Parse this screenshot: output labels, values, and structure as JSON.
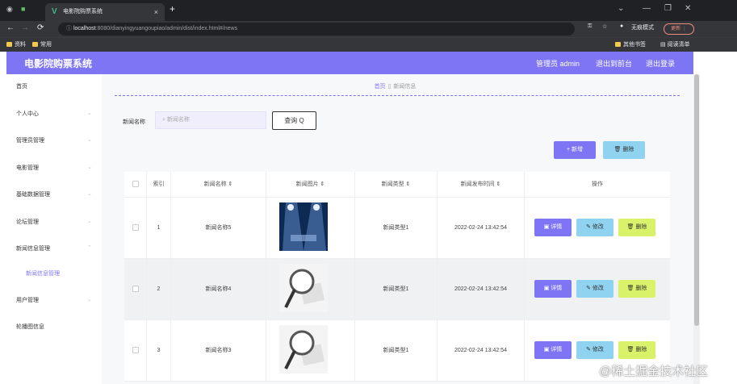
{
  "browser": {
    "tab_title": "电影院购票系统",
    "tab_favicon": "V",
    "close_tab": "×",
    "new_tab": "+",
    "address_host": "localhost",
    "address_rest": ":8080/dianyingyuangoupiao/admin/dist/index.html#/news",
    "incognito_label": "无痕模式",
    "profile_label": "更新 ⋮",
    "bookmarks": [
      "资料",
      "常用"
    ],
    "bookmarks_right": [
      "其他书签",
      "阅读清单"
    ]
  },
  "header": {
    "title": "电影院购票系统",
    "admin_label": "管理员 admin",
    "back_label": "退出到前台",
    "logout_label": "退出登录"
  },
  "sidebar": {
    "items": [
      {
        "label": "首页",
        "has_chevron": false
      },
      {
        "label": "个人中心",
        "has_chevron": true
      },
      {
        "label": "管理员管理",
        "has_chevron": true
      },
      {
        "label": "电影管理",
        "has_chevron": true
      },
      {
        "label": "基础数据管理",
        "has_chevron": true
      },
      {
        "label": "论坛管理",
        "has_chevron": true
      },
      {
        "label": "新闻信息管理",
        "has_chevron": true
      },
      {
        "label": "新闻信息管理",
        "sub": true
      },
      {
        "label": "用户管理",
        "has_chevron": true
      },
      {
        "label": "轮播图信息",
        "has_chevron": false
      }
    ]
  },
  "breadcrumb": {
    "home": "首页",
    "current": "新闻信息"
  },
  "search": {
    "label": "新闻名称",
    "placeholder": "新闻名称",
    "button_label": "查询 Q"
  },
  "actions": {
    "add_label": "+ 新增",
    "delete_label": "删除"
  },
  "table": {
    "headers": [
      "",
      "索引",
      "新闻名称 ⇕",
      "新闻图片 ⇕",
      "新闻类型 ⇕",
      "新闻发布时间 ⇕",
      "操作"
    ],
    "rows": [
      {
        "index": "1",
        "name": "新闻名称5",
        "image": "stage-image",
        "type": "新闻类型1",
        "time": "2022-02-24 13:42:54"
      },
      {
        "index": "2",
        "name": "新闻名称4",
        "image": "news-magnifier-image",
        "type": "新闻类型1",
        "time": "2022-02-24 13:42:54"
      },
      {
        "index": "3",
        "name": "新闻名称3",
        "image": "news-magnifier-image",
        "type": "新闻类型1",
        "time": "2022-02-24 13:42:54"
      }
    ],
    "op_labels": {
      "detail": "详情",
      "edit": "修改",
      "delete": "删除"
    }
  },
  "watermark": "@稀土掘金技术社区",
  "colors": {
    "accent": "#7e75f5",
    "info": "#8fd3f0",
    "warning": "#d8f36a"
  }
}
